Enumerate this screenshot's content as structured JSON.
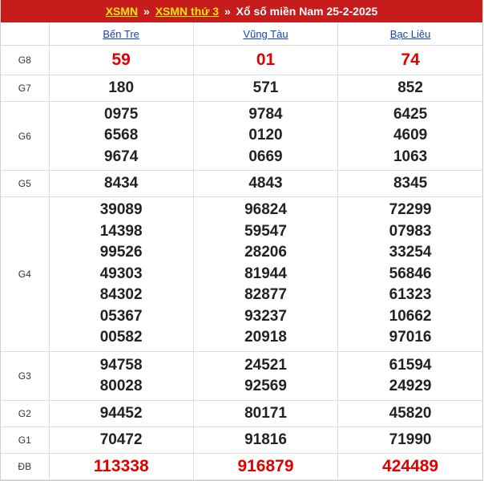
{
  "header": {
    "link1": "XSMN",
    "sep1": "»",
    "link2": "XSMN thứ 3",
    "sep2": "»",
    "title": "Xổ số miền Nam 25-2-2025"
  },
  "provinces": [
    "Bến Tre",
    "Vũng Tàu",
    "Bạc Liêu"
  ],
  "rows": [
    {
      "key": "g8",
      "label": "G8",
      "highlight": true,
      "values": [
        [
          "59"
        ],
        [
          "01"
        ],
        [
          "74"
        ]
      ]
    },
    {
      "key": "g7",
      "label": "G7",
      "values": [
        [
          "180"
        ],
        [
          "571"
        ],
        [
          "852"
        ]
      ]
    },
    {
      "key": "g6",
      "label": "G6",
      "values": [
        [
          "0975",
          "6568",
          "9674"
        ],
        [
          "9784",
          "0120",
          "0669"
        ],
        [
          "6425",
          "4609",
          "1063"
        ]
      ]
    },
    {
      "key": "g5",
      "label": "G5",
      "values": [
        [
          "8434"
        ],
        [
          "4843"
        ],
        [
          "8345"
        ]
      ]
    },
    {
      "key": "g4",
      "label": "G4",
      "values": [
        [
          "39089",
          "14398",
          "99526",
          "49303",
          "84302",
          "05367",
          "00582"
        ],
        [
          "96824",
          "59547",
          "28206",
          "81944",
          "82877",
          "93237",
          "20918"
        ],
        [
          "72299",
          "07983",
          "33254",
          "56846",
          "61323",
          "10662",
          "97016"
        ]
      ]
    },
    {
      "key": "g3",
      "label": "G3",
      "values": [
        [
          "94758",
          "80028"
        ],
        [
          "24521",
          "92569"
        ],
        [
          "61594",
          "24929"
        ]
      ]
    },
    {
      "key": "g2",
      "label": "G2",
      "values": [
        [
          "94452"
        ],
        [
          "80171"
        ],
        [
          "45820"
        ]
      ]
    },
    {
      "key": "g1",
      "label": "G1",
      "values": [
        [
          "70472"
        ],
        [
          "91816"
        ],
        [
          "71990"
        ]
      ]
    },
    {
      "key": "db",
      "label": "ĐB",
      "highlight": true,
      "values": [
        [
          "113338"
        ],
        [
          "916879"
        ],
        [
          "424489"
        ]
      ]
    }
  ],
  "colors": {
    "header_bg": "#c61c1c",
    "link_yellow": "#ffe400",
    "province_link": "#1745b0",
    "special_red": "#e00000"
  }
}
